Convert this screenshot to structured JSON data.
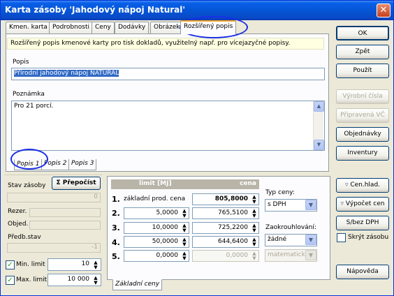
{
  "window": {
    "title": "Karta zásoby 'Jahodový nápoj Natural'"
  },
  "tabs": [
    {
      "label": "Kmen. karta"
    },
    {
      "label": "Podrobnosti"
    },
    {
      "label": "Ceny"
    },
    {
      "label": "Dodávky"
    },
    {
      "label": "Obrázek"
    },
    {
      "label": "Rozšířený popis"
    }
  ],
  "extended": {
    "info": "Rozšířený popis kmenové karty pro tisk dokladů, využitelný např. pro vícejazyčné popisy.",
    "popis_label": "Popis",
    "popis_value": "Přírodní jahodový nápoj NATURAL",
    "poznamka_label": "Poznámka",
    "poznamka_value": "Pro 21 porcí."
  },
  "subtabs": [
    {
      "label": "Popis 1"
    },
    {
      "label": "Popis 2"
    },
    {
      "label": "Popis 3"
    }
  ],
  "stock": {
    "stav_label": "Stav zásoby",
    "prepocist_label": "Σ Přepočíst",
    "stav_value": "0",
    "rezer_label": "Rezer.",
    "objed_label": "Objed.",
    "predb_label": "Předb.stav",
    "predb_value": "-1",
    "min_label": "Min. limit",
    "min_value": "10",
    "max_label": "Max. limit",
    "max_value": "10 000"
  },
  "prices": {
    "header_limit": "limit [MJ]",
    "header_cena": "cena",
    "rows": [
      {
        "num": "1.",
        "limit": "základní prod. cena",
        "cena": "805,8000"
      },
      {
        "num": "2.",
        "limit": "5,0000",
        "cena": "765,5100"
      },
      {
        "num": "3.",
        "limit": "10,0000",
        "cena": "725,2200"
      },
      {
        "num": "4.",
        "limit": "50,0000",
        "cena": "644,6400"
      },
      {
        "num": "5.",
        "limit": "0,0000",
        "cena": "0,0000"
      }
    ],
    "typ_label": "Typ ceny:",
    "typ_value": "s DPH",
    "zaok_label": "Zaokrouhlování:",
    "zaok_value": "žádné",
    "zaok_method": "matematicky",
    "tab_label": "Základní ceny"
  },
  "buttons": {
    "ok": "OK",
    "zpet": "Zpět",
    "pouzit": "Použít",
    "vyrobni": "Výrobní čísla",
    "pripravena": "Připravená VČ",
    "objednavky": "Objednávky",
    "inventury": "Inventury",
    "cen_hlad": "Cen.hlad.",
    "vypocet": "Výpočet cen",
    "sbez": "S/bez DPH",
    "skryt": "Skrýt zásobu",
    "napoveda": "Nápověda"
  }
}
